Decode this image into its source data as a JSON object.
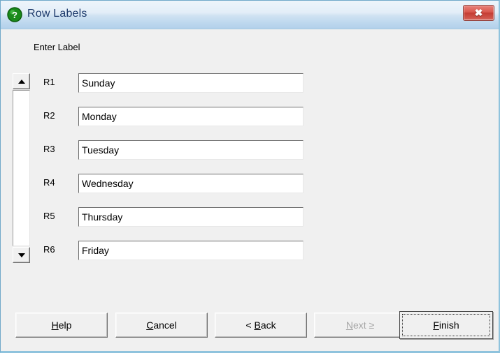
{
  "window": {
    "title": "Row Labels",
    "icon": "help-question-icon",
    "close_label": "✖",
    "accent_title_color": "#1d3a6b",
    "close_button_color": "#c43c33",
    "icon_color": "#1a8a1a"
  },
  "content": {
    "heading": "Enter Label",
    "rows": [
      {
        "label": "R1",
        "value": "Sunday"
      },
      {
        "label": "R2",
        "value": "Monday"
      },
      {
        "label": "R3",
        "value": "Tuesday"
      },
      {
        "label": "R4",
        "value": "Wednesday"
      },
      {
        "label": "R5",
        "value": "Thursday"
      },
      {
        "label": "R6",
        "value": "Friday"
      }
    ]
  },
  "scrollbar": {
    "up_arrow": "▲",
    "down_arrow": "▼"
  },
  "buttons": {
    "help": {
      "prefix": "",
      "accel": "H",
      "suffix": "elp",
      "disabled": false
    },
    "cancel": {
      "prefix": "",
      "accel": "C",
      "suffix": "ancel",
      "disabled": false
    },
    "back": {
      "prefix": "< ",
      "accel": "B",
      "suffix": "ack",
      "disabled": false
    },
    "next": {
      "prefix": "",
      "accel": "N",
      "suffix": "ext ≥",
      "disabled": true
    },
    "finish": {
      "prefix": "",
      "accel": "F",
      "suffix": "inish",
      "disabled": false,
      "is_default": true
    }
  }
}
